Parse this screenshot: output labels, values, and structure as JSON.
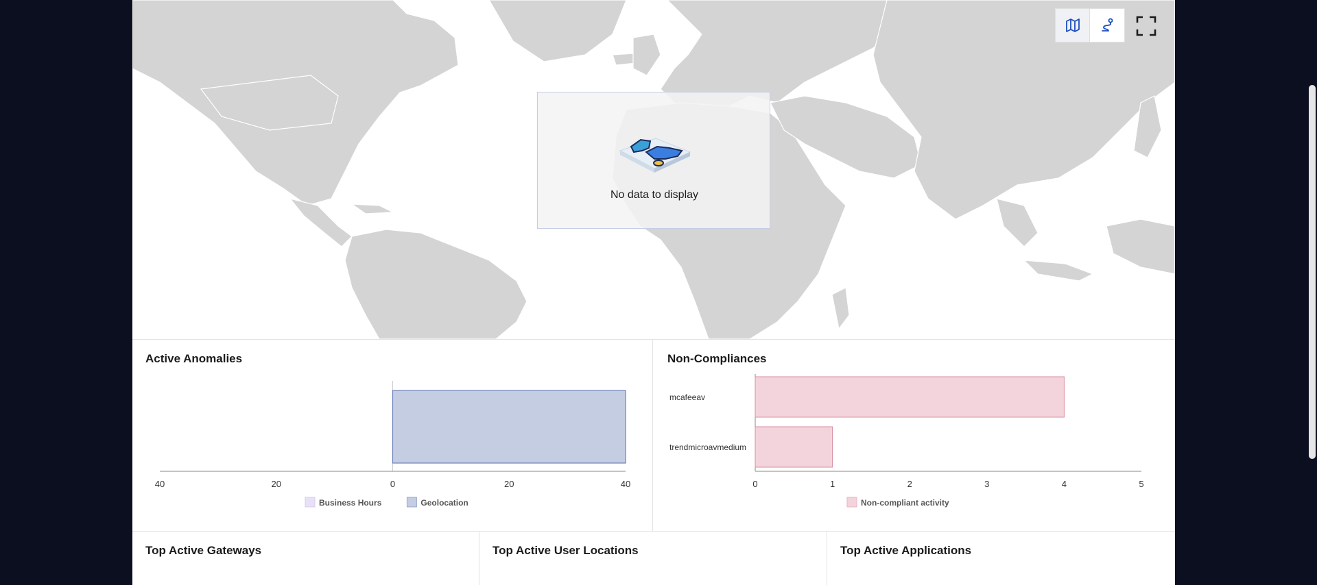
{
  "map": {
    "empty_message": "No data to display",
    "toolbar": {
      "map_view_icon": "map-icon",
      "route_view_icon": "route-icon",
      "fullscreen_icon": "fullscreen-icon"
    }
  },
  "panels": {
    "active_anomalies": {
      "title": "Active Anomalies"
    },
    "non_compliances": {
      "title": "Non-Compliances"
    },
    "top_gateways": {
      "title": "Top Active Gateways"
    },
    "top_user_locations": {
      "title": "Top Active User Locations"
    },
    "top_applications": {
      "title": "Top Active Applications"
    }
  },
  "chart_data": [
    {
      "type": "bar",
      "orientation": "horizontal-diverging",
      "title": "Active Anomalies",
      "series": [
        {
          "name": "Business Hours",
          "values": [
            0
          ],
          "color": "#e8e0f7"
        },
        {
          "name": "Geolocation",
          "values": [
            40
          ],
          "color": "#c5cde3"
        }
      ],
      "x_ticks": [
        "40",
        "20",
        "0",
        "20",
        "40"
      ],
      "xlim": [
        -40,
        40
      ],
      "legend": "bottom"
    },
    {
      "type": "bar",
      "orientation": "horizontal",
      "title": "Non-Compliances",
      "categories": [
        "mcafeeav",
        "trendmicroavmedium"
      ],
      "series": [
        {
          "name": "Non-compliant activity",
          "values": [
            4,
            1
          ],
          "color": "#f4d4dc"
        }
      ],
      "x_ticks": [
        "0",
        "1",
        "2",
        "3",
        "4",
        "5"
      ],
      "xlim": [
        0,
        5
      ],
      "legend": "bottom"
    }
  ]
}
